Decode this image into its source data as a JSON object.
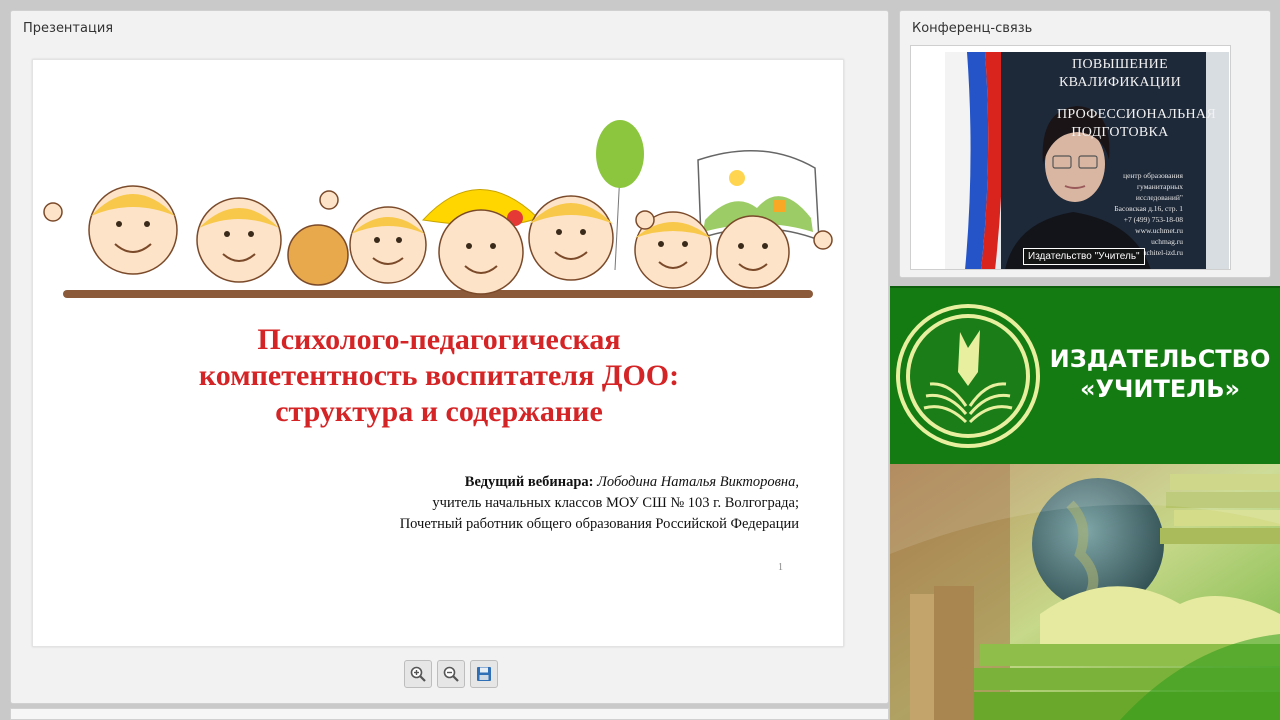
{
  "presentation": {
    "panel_title": "Презентация",
    "slide": {
      "title_lines": [
        "Психолого-педагогическая",
        "компетентность воспитателя ДОО:",
        "структура и содержание"
      ],
      "presenter_label": "Ведущий вебинара:",
      "presenter_name": "Лободина Наталья Викторовна",
      "presenter_name_suffix": ",",
      "presenter_role": "учитель начальных классов МОУ СШ № 103 г. Волгограда;",
      "presenter_title": "Почетный работник общего образования Российской Федерации",
      "page_number": "1"
    },
    "toolbar": {
      "zoom_in_icon": "zoom-in-icon",
      "zoom_out_icon": "zoom-out-icon",
      "save_icon": "save-icon"
    }
  },
  "conference": {
    "panel_title": "Конференц-связь",
    "banner_lines": [
      "ПОВЫШЕНИЕ",
      "КВАЛИФИКАЦИИ",
      "ПРОФЕССИОНАЛЬНАЯ",
      "ПОДГОТОВКА"
    ],
    "banner_small_lines": [
      "центр образования",
      "гуманитарных исследований\"",
      "Басовская д.16, стр. 1",
      "+7 (499) 753-18-08",
      "www.uchmet.ru",
      "uchmag.ru",
      "uchitel-izd.ru"
    ],
    "participant_name": "Издательство \"Учитель\""
  },
  "brand": {
    "line1": "ИЗДАТЕЛЬСТВО",
    "line2": "«УЧИТЕЛЬ»"
  },
  "colors": {
    "title_red": "#d42426",
    "brand_green": "#137b12"
  }
}
